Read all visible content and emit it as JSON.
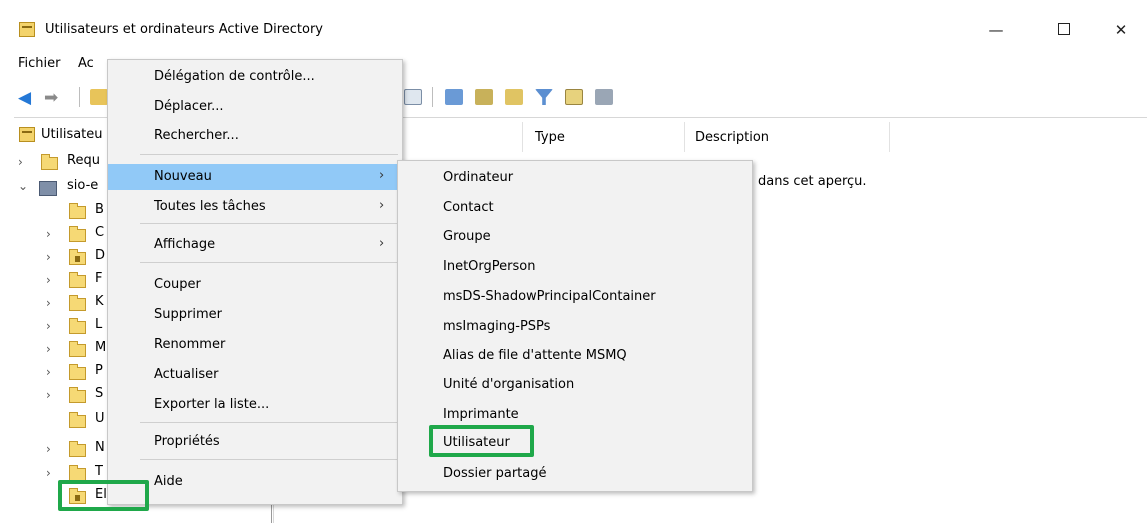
{
  "window": {
    "title": "Utilisateurs et ordinateurs Active Directory",
    "controls": {
      "minimize": "—",
      "maximize": "",
      "close": "✕"
    }
  },
  "menubar": {
    "items": [
      "Fichier",
      "Ac"
    ]
  },
  "list": {
    "columns": [
      "Type",
      "Description"
    ],
    "empty_message": "dans cet aperçu."
  },
  "tree": {
    "root_label": "Utilisateu",
    "items": [
      {
        "label": "Requ"
      },
      {
        "label": "sio-e"
      },
      {
        "label": "B"
      },
      {
        "label": "C"
      },
      {
        "label": "D"
      },
      {
        "label": "F"
      },
      {
        "label": "K"
      },
      {
        "label": "L"
      },
      {
        "label": "M"
      },
      {
        "label": "P"
      },
      {
        "label": "S"
      },
      {
        "label": "U"
      },
      {
        "label": "N"
      },
      {
        "label": "T"
      },
      {
        "label": "Eleves"
      }
    ]
  },
  "context_menu": {
    "items": [
      {
        "label": "Délégation de contrôle..."
      },
      {
        "label": "Déplacer..."
      },
      {
        "label": "Rechercher..."
      },
      {
        "label": "Nouveau",
        "submenu": "›"
      },
      {
        "label": "Toutes les tâches",
        "submenu": "›"
      },
      {
        "label": "Affichage",
        "submenu": "›"
      },
      {
        "label": "Couper"
      },
      {
        "label": "Supprimer"
      },
      {
        "label": "Renommer"
      },
      {
        "label": "Actualiser"
      },
      {
        "label": "Exporter la liste..."
      },
      {
        "label": "Propriétés"
      },
      {
        "label": "Aide"
      }
    ]
  },
  "submenu": {
    "items": [
      {
        "label": "Ordinateur"
      },
      {
        "label": "Contact"
      },
      {
        "label": "Groupe"
      },
      {
        "label": "InetOrgPerson"
      },
      {
        "label": "msDS-ShadowPrincipalContainer"
      },
      {
        "label": "msImaging-PSPs"
      },
      {
        "label": "Alias de file d'attente MSMQ"
      },
      {
        "label": "Unité d'organisation"
      },
      {
        "label": "Imprimante"
      },
      {
        "label": "Utilisateur"
      },
      {
        "label": "Dossier partagé"
      }
    ]
  },
  "colors": {
    "highlight": "#91c9f7",
    "annotation": "#1fa84a",
    "menu_bg": "#f2f2f2"
  }
}
